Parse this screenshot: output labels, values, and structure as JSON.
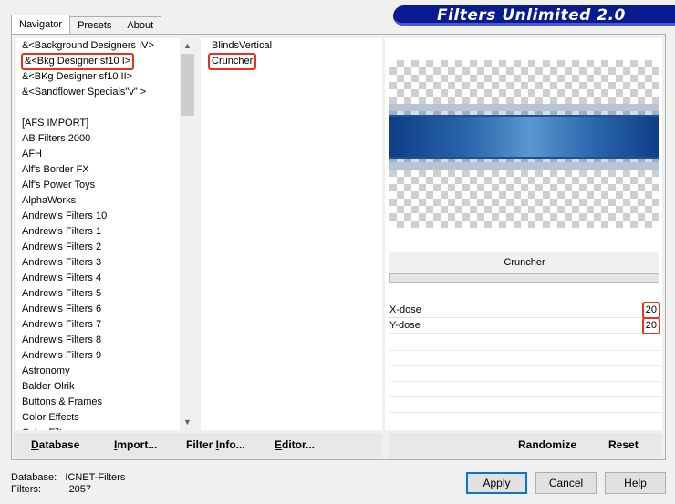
{
  "tabs": [
    "Navigator",
    "Presets",
    "About"
  ],
  "banner": "Filters Unlimited 2.0",
  "categories": [
    "&<Background Designers IV>",
    "&<Bkg Designer sf10 I>",
    "&<BKg Designer sf10 II>",
    "&<Sandflower Specials\"v\" >",
    "",
    "[AFS IMPORT]",
    "AB Filters 2000",
    "AFH",
    "Alf's Border FX",
    "Alf's Power Toys",
    "AlphaWorks",
    "Andrew's Filters 10",
    "Andrew's Filters 1",
    "Andrew's Filters 2",
    "Andrew's Filters 3",
    "Andrew's Filters 4",
    "Andrew's Filters 5",
    "Andrew's Filters 6",
    "Andrew's Filters 7",
    "Andrew's Filters 8",
    "Andrew's Filters 9",
    "Astronomy",
    "Balder Olrik",
    "Buttons & Frames",
    "Color Effects",
    "Color Filters"
  ],
  "selected_category": "&<Bkg Designer sf10 I>",
  "filters": [
    "BlindsVertical",
    "Cruncher"
  ],
  "selected_filter": "Cruncher",
  "filter_name": "Cruncher",
  "params": [
    {
      "label": "X-dose",
      "value": "20"
    },
    {
      "label": "Y-dose",
      "value": "20"
    }
  ],
  "left_buttons": {
    "database": {
      "u": "D",
      "rest": "atabase"
    },
    "import": {
      "u": "I",
      "rest": "mport..."
    },
    "filterinfo": {
      "pre": "Filter ",
      "u": "I",
      "rest": "nfo..."
    },
    "editor": {
      "u": "E",
      "rest": "ditor..."
    }
  },
  "right_buttons": {
    "randomize": "Randomize",
    "reset": "Reset"
  },
  "status": {
    "database_label": "Database:",
    "database_value": "ICNET-Filters",
    "filters_label": "Filters:",
    "filters_value": "2057"
  },
  "dialog_buttons": {
    "apply": "Apply",
    "cancel": "Cancel",
    "help": "Help"
  },
  "colors": {
    "highlight": "#e8321f",
    "banner": "#0a1a8f",
    "band": "#2c67ad"
  }
}
